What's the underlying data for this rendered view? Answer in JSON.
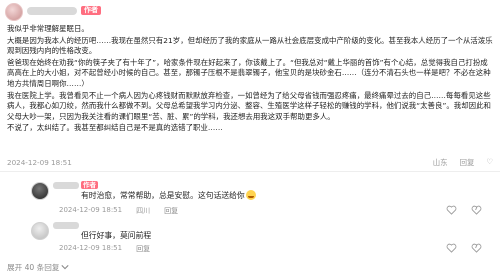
{
  "post": {
    "author_badge": "作者",
    "paragraphs": [
      "我似乎非常理解星眠日。",
      "大概是因为我本人的经历吧……我现在虽然只有21岁，但却经历了我的家庭从一路从社会底层变成中产阶级的变化。甚至我本人经历了一个从活泼乐观到因残内向的性格改变。",
      "爸爸现在始终在劝我“你的筷子夹了有十年了”，哈家条件现在好起来了，你该戴上了。“但我总对“戴上华丽的首饰”有个心结，总觉得我自己打扮成高高在上的大小姐，对不起曾经小时候的自己。甚至，那镯子压根不是翡翠镯子，他宝贝的是块砂金石……（连分不清石头也一样是吧？不必在这种地方共情周日啊你……）",
      "我在医院上学。我曾看见不止一个病人因为心疼钱财而默默放弃检查，一如曾经为了给父母省钱而强忍疼痛，最终痛晕过去的自己……每每看见这些病人，我都心如刀绞，然而我什么都做不到。父母总希望我学习内分泌、整容、生殖医学这样子轻松的赚钱的学科，他们说我“太善良”。我却因此和父母大吵一架，只因为我关注看的课们眼里“苦、脏、累”的学科，我还想去用我这双手帮助更多人。",
      "不说了，太纠结了。我甚至都纠结自己是不是真的选错了职业……"
    ],
    "date": "2024-12-09 18:51",
    "location": "山东",
    "actions": [
      "回复",
      "♡"
    ]
  },
  "replies": [
    {
      "badge": "作者",
      "text": "有时治愈，常常帮助，总是安慰。这句话送给你",
      "date": "2024-12-09 18:51",
      "location": "四川",
      "reply_label": "回复"
    },
    {
      "badge": "",
      "text": "但行好事，莫问前程",
      "date": "2024-12-09 18:51",
      "location": "",
      "reply_label": "回复"
    }
  ],
  "more_replies": {
    "label": "展开 40 条回复",
    "icon": "chevron-down-icon"
  },
  "colors": {
    "badge": "#ff6e80",
    "meta": "#9a9a9a",
    "emoji": "#ffd34f"
  }
}
